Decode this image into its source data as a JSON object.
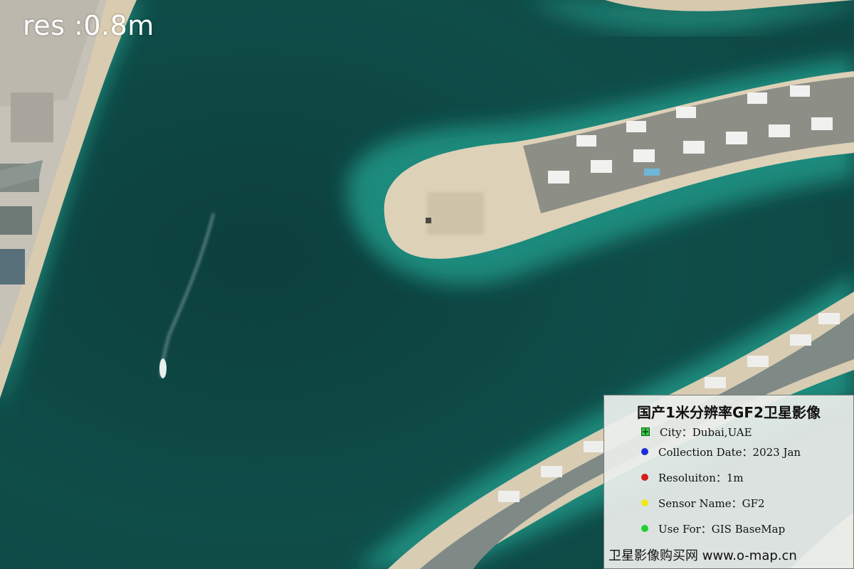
{
  "overlay": {
    "resolution_label": "res :0.8m"
  },
  "legend": {
    "title": "国产1米分辨率GF2卫星影像",
    "items": [
      {
        "icon": "city-marker-icon",
        "color": "#2ecc40",
        "text": "City：Dubai,UAE"
      },
      {
        "icon": "blue-dot-icon",
        "color": "#1f2bd6",
        "text": "Collection Date：2023 Jan"
      },
      {
        "icon": "red-dot-icon",
        "color": "#d61f1f",
        "text": "Resoluiton：1m"
      },
      {
        "icon": "yellow-dot-icon",
        "color": "#f2e61b",
        "text": "Sensor Name：GF2"
      },
      {
        "icon": "green-dot-icon",
        "color": "#22d12e",
        "text": "Use For：GIS BaseMap"
      }
    ],
    "footer": "卫星影像购买网 www.o-map.cn"
  }
}
